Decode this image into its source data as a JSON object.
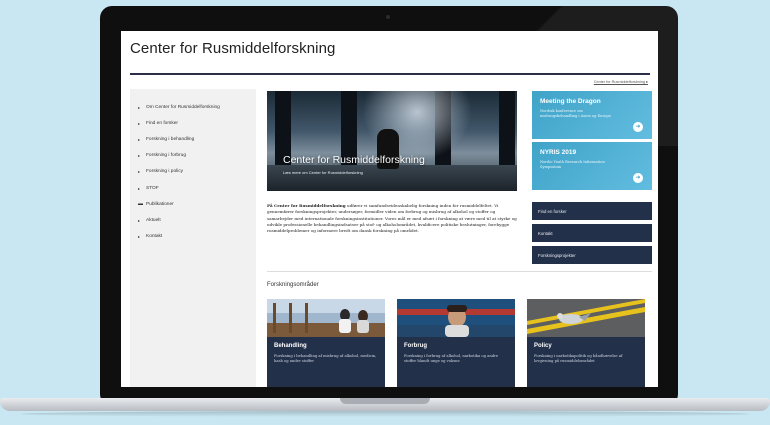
{
  "site": {
    "title": "Center for Rusmiddelforskning",
    "top_link": "Center for Rusmiddelforskning ▸"
  },
  "sidebar": {
    "items": [
      {
        "label": "Om Center for Rusmiddelforskning",
        "icon": "arrow-right-icon"
      },
      {
        "label": "Find en forsker",
        "icon": "arrow-right-icon"
      },
      {
        "label": "Forskning i behandling",
        "icon": "arrow-right-icon"
      },
      {
        "label": "Forskning i forbrug",
        "icon": "arrow-right-icon"
      },
      {
        "label": "Forskning i policy",
        "icon": "arrow-right-icon"
      },
      {
        "label": "STOF",
        "icon": "arrow-right-icon"
      },
      {
        "label": "Publikationer",
        "icon": "dash-icon"
      },
      {
        "label": "Aktuelt",
        "icon": "arrow-right-icon"
      },
      {
        "label": "Kontakt",
        "icon": "arrow-right-icon"
      }
    ]
  },
  "hero": {
    "title": "Center for Rusmiddelforskning",
    "subtitle": "Læs mere om Center for Rusmiddelforskning"
  },
  "promos": [
    {
      "title": "Meeting the Dragon",
      "text": "Nordisk konference om misbrugsbehandling i Asien og Europa",
      "color": "#4aaed3"
    },
    {
      "title": "NYRIS 2019",
      "text": "Nordic Youth Research Information Symposium",
      "color": "#4aaed3"
    }
  ],
  "intro": {
    "lead": "På Center for Rusmiddelforskning",
    "body": " udfører vi samfundsvidenskabelig forskning inden for rusmiddelfeltet. Vi gennemfører forskningsprojekter, undersøger, formidler viden om forbrug og misbrug af alkohol og stoffer og samarbejder med internationale forskningsinstitutioner. Vores mål er med afsæt i forskning at være med til at styrke og udvikle professionelle behandlingsindsatser på stof- og alkoholområdet, kvalificere politiske beslutninger, forebygge rusmiddelproblemer og informere bredt om dansk forskning på området."
  },
  "quick_links": [
    "Find en forsker",
    "Kontakt",
    "Forskningsprojekter"
  ],
  "section_title": "Forskningsområder",
  "cards": [
    {
      "title": "Behandling",
      "text": "Forskning i behandling af misbrug af alkohol, medicin, hash og andre stoffer"
    },
    {
      "title": "Forbrug",
      "text": "Forskning i forbrug af alkohol, narkotika og andre stoffer blandt unge og voksne"
    },
    {
      "title": "Policy",
      "text": "Forskning i narkotikapolitik og håndhævelse af lovgivning på rusmiddelområdet"
    }
  ]
}
